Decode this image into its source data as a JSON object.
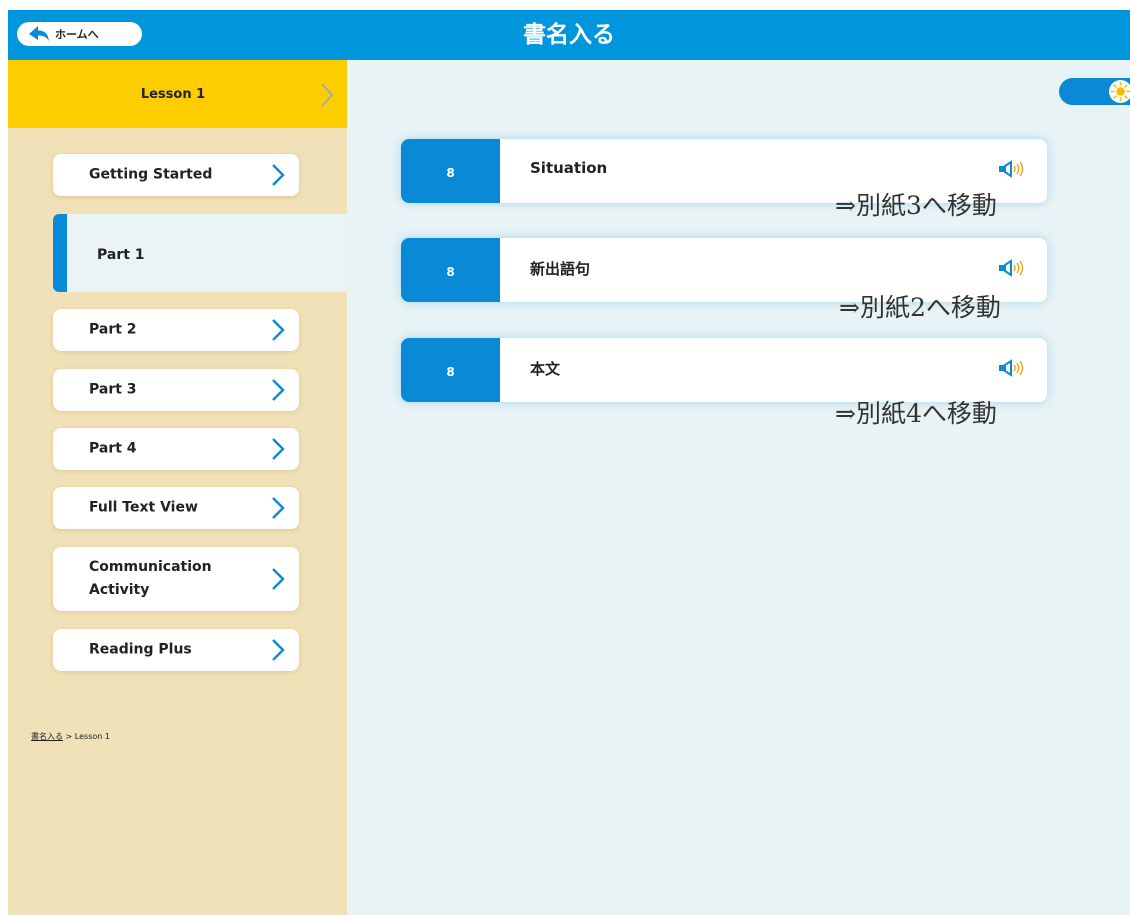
{
  "header": {
    "home_label": "ホームへ",
    "title": "書名入る"
  },
  "sidebar": {
    "lesson_title": "Lesson 1",
    "items": [
      {
        "label": "Getting Started"
      },
      {
        "label": "Part 1",
        "active": true
      },
      {
        "label": "Part 2"
      },
      {
        "label": "Part 3"
      },
      {
        "label": "Part 4"
      },
      {
        "label": "Full Text View"
      },
      {
        "label": "Communication Activity"
      },
      {
        "label": "Reading Plus"
      }
    ]
  },
  "breadcrumb": {
    "root": "書名入る",
    "separator": " > ",
    "current": "Lesson 1"
  },
  "cards": [
    {
      "number": "8",
      "title": "Situation",
      "icon": "speaker-icon",
      "note": "⇒別紙3へ移動"
    },
    {
      "number": "8",
      "title": "新出語句",
      "icon": "speaker-icon",
      "note": "⇒別紙2へ移動"
    },
    {
      "number": "8",
      "title": "本文",
      "icon": "speaker-icon",
      "note": "⇒別紙4へ移動"
    }
  ],
  "colors": {
    "header_blue": "#0096dd",
    "accent_blue": "#0a8ad6",
    "lesson_yellow": "#fecd00",
    "sidebar_bg": "#f1e1b8",
    "main_bg": "#e8f3f5"
  }
}
